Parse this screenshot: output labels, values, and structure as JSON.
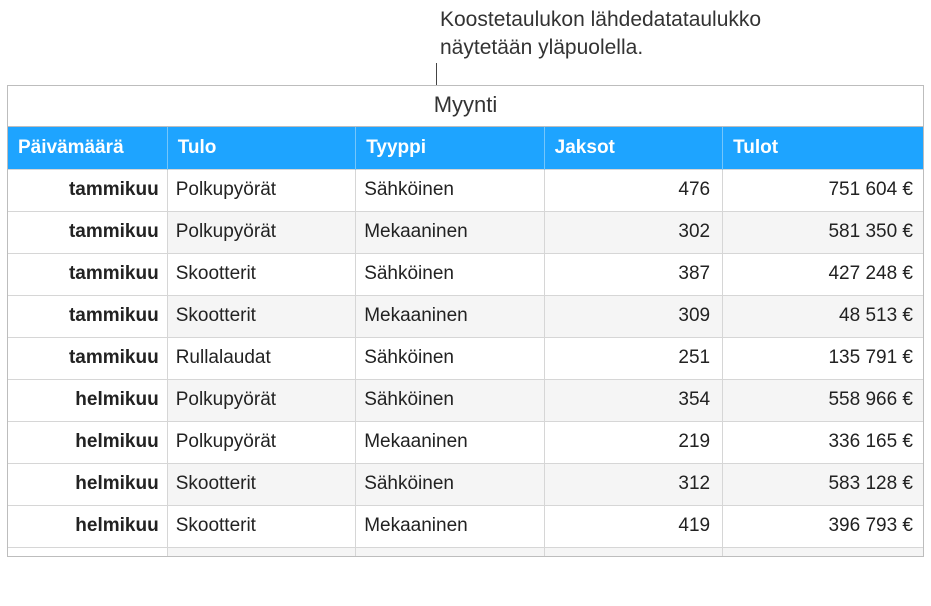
{
  "callout": {
    "line1": "Koostetaulukon lähdedatataulukko",
    "line2": "näytetään yläpuolella."
  },
  "table": {
    "title": "Myynti",
    "headers": {
      "c1": "Päivämäärä",
      "c2": "Tulo",
      "c3": "Tyyppi",
      "c4": "Jaksot",
      "c5": "Tulot"
    },
    "rows": [
      {
        "date": "tammikuu",
        "income": "Polkupyörät",
        "type": "Sähköinen",
        "periods": "476",
        "revenue": "751 604  €",
        "alt": false
      },
      {
        "date": "tammikuu",
        "income": "Polkupyörät",
        "type": "Mekaaninen",
        "periods": "302",
        "revenue": "581 350  €",
        "alt": true
      },
      {
        "date": "tammikuu",
        "income": "Skootterit",
        "type": "Sähköinen",
        "periods": "387",
        "revenue": "427 248  €",
        "alt": false
      },
      {
        "date": "tammikuu",
        "income": "Skootterit",
        "type": "Mekaaninen",
        "periods": "309",
        "revenue": "48 513  €",
        "alt": true
      },
      {
        "date": "tammikuu",
        "income": "Rullalaudat",
        "type": "Sähköinen",
        "periods": "251",
        "revenue": "135 791  €",
        "alt": false
      },
      {
        "date": "helmikuu",
        "income": "Polkupyörät",
        "type": "Sähköinen",
        "periods": "354",
        "revenue": "558 966  €",
        "alt": true
      },
      {
        "date": "helmikuu",
        "income": "Polkupyörät",
        "type": "Mekaaninen",
        "periods": "219",
        "revenue": "336 165  €",
        "alt": false
      },
      {
        "date": "helmikuu",
        "income": "Skootterit",
        "type": "Sähköinen",
        "periods": "312",
        "revenue": "583 128  €",
        "alt": true
      },
      {
        "date": "helmikuu",
        "income": "Skootterit",
        "type": "Mekaaninen",
        "periods": "419",
        "revenue": "396 793  €",
        "alt": false
      }
    ]
  }
}
